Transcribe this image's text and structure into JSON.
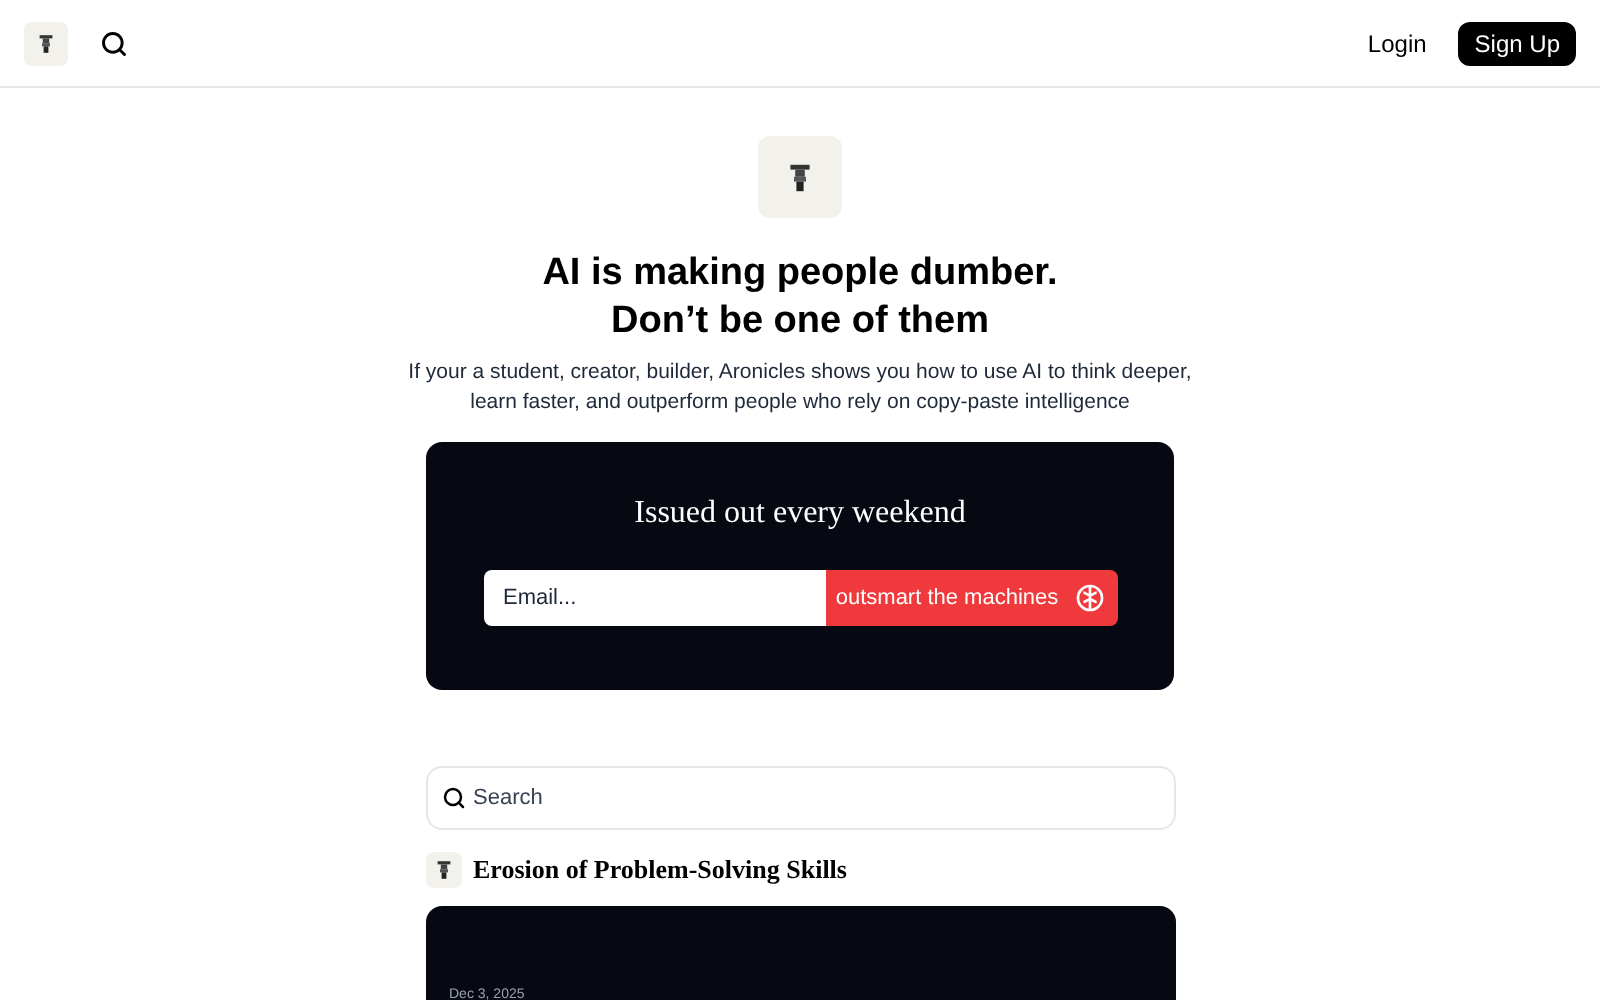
{
  "nav": {
    "login": "Login",
    "signup": "Sign Up"
  },
  "hero": {
    "title_lines": [
      "AI is making people dumber.",
      "Don’t be one of them"
    ],
    "subtitle": "If your a student, creator, builder, Aronicles shows you how to use AI to think deeper, learn faster, and outperform people who rely on copy-paste intelligence"
  },
  "signup_card": {
    "heading": "Issued out every weekend",
    "email": {
      "placeholder": "Email..."
    },
    "button": "outsmart the machines"
  },
  "search": {
    "placeholder": "Search"
  },
  "posts": [
    {
      "title": "Erosion of Problem-Solving Skills",
      "date": "Dec 3, 2025"
    }
  ]
}
